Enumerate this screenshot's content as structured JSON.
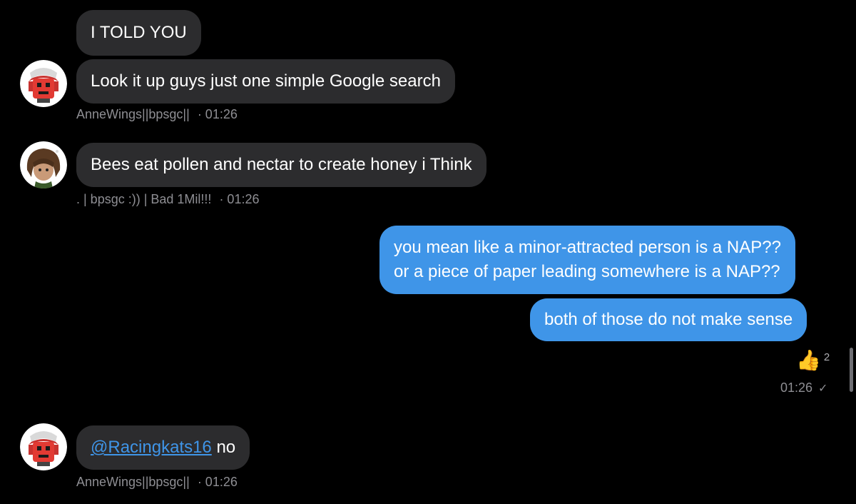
{
  "messages": [
    {
      "id": "m1",
      "direction": "in",
      "text": "I TOLD YOU"
    },
    {
      "id": "m2",
      "direction": "in",
      "text": "Look it up guys just one simple Google search",
      "sender": "AnneWings||bpsgc||",
      "time": "· 01:26",
      "avatar": "red-robot-avatar"
    },
    {
      "id": "m3",
      "direction": "in",
      "text": "Bees eat pollen and nectar to create honey i Think",
      "sender": ". | bpsgc :)) | Bad 1Mil!!!",
      "time": "· 01:26",
      "avatar": "brown-hair-avatar"
    },
    {
      "id": "m4",
      "direction": "out",
      "line1": "you mean like a minor-attracted person is a NAP??",
      "line2": "or a piece of paper leading somewhere is a NAP??"
    },
    {
      "id": "m5",
      "direction": "out",
      "text": "both of those do not make sense",
      "reaction_emoji": "👍",
      "reaction_count": "2",
      "time": "01:26",
      "status": "✓"
    },
    {
      "id": "m6",
      "direction": "in",
      "mention": "@Racingkats16",
      "text": " no",
      "sender": "AnneWings||bpsgc||",
      "time": "· 01:26",
      "avatar": "red-robot-avatar"
    }
  ],
  "colors": {
    "background": "#000000",
    "incoming_bubble": "#2c2c2e",
    "outgoing_bubble": "#3f95e8",
    "meta_text": "#8e8e93",
    "mention": "#3f95e8"
  }
}
